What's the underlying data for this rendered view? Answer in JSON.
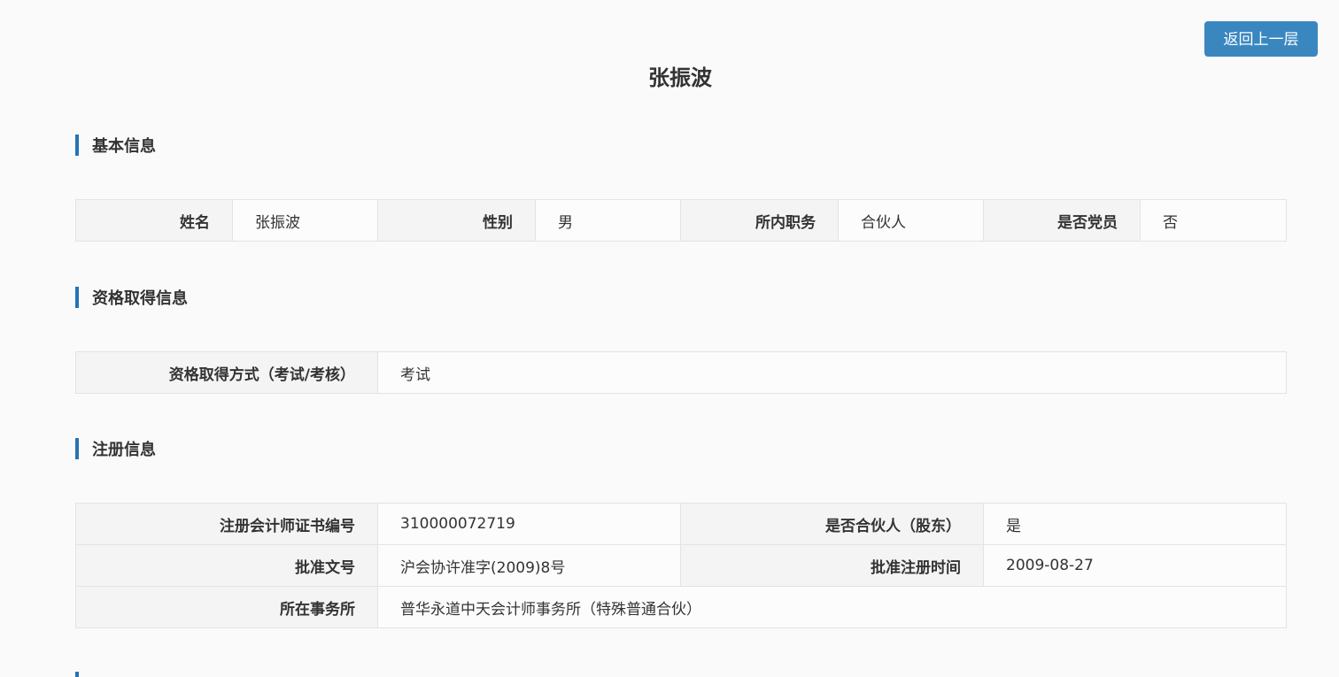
{
  "header": {
    "back_label": "返回上一层",
    "title": "张振波"
  },
  "basic": {
    "section_title": "基本信息",
    "name_label": "姓名",
    "name_value": "张振波",
    "gender_label": "性别",
    "gender_value": "男",
    "position_label": "所内职务",
    "position_value": "合伙人",
    "party_label": "是否党员",
    "party_value": "否"
  },
  "qualification": {
    "section_title": "资格取得信息",
    "method_label": "资格取得方式（考试/考核）",
    "method_value": "考试"
  },
  "registration": {
    "section_title": "注册信息",
    "cert_label": "注册会计师证书编号",
    "cert_value": "310000072719",
    "partner_label": "是否合伙人（股东）",
    "partner_value": "是",
    "approval_label": "批准文号",
    "approval_value": "沪会协许准字(2009)8号",
    "date_label": "批准注册时间",
    "date_value": "2009-08-27",
    "firm_label": "所在事务所",
    "firm_value": "普华永道中天会计师事务所（特殊普通合伙）"
  },
  "colors": {
    "accent": "#2573b5",
    "button": "#3a87c0"
  }
}
